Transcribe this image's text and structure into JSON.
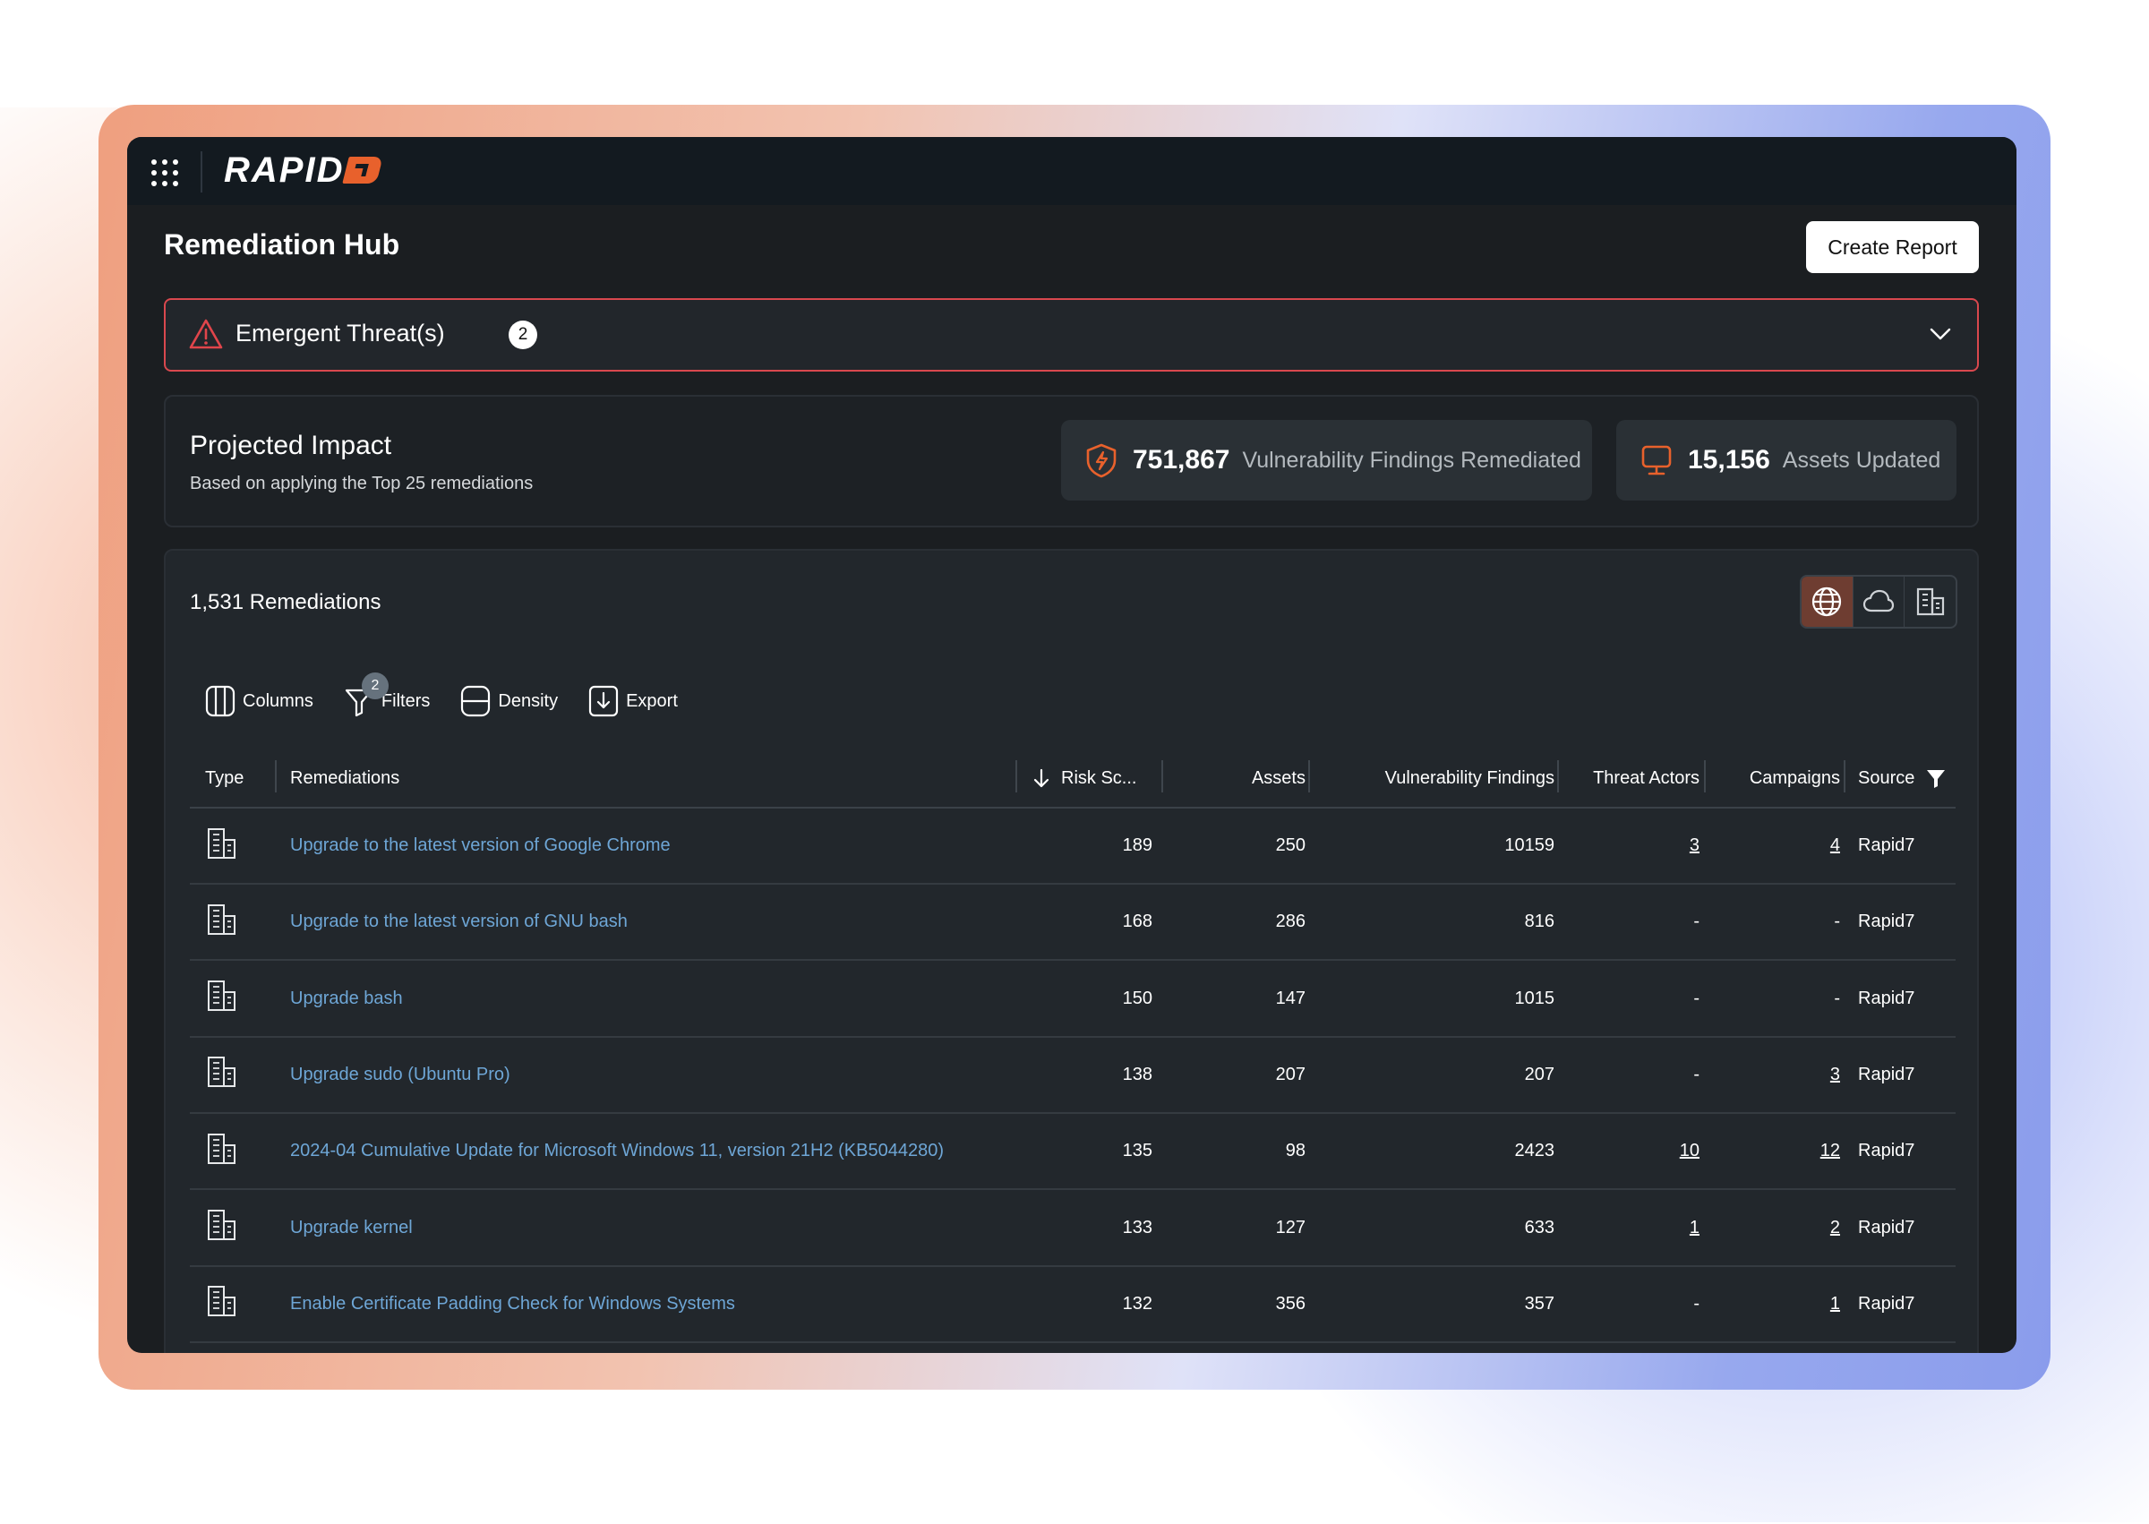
{
  "app": {
    "logo_text": "RAPID",
    "page_title": "Remediation Hub",
    "create_report_label": "Create Report"
  },
  "emergent": {
    "label": "Emergent Threat(s)",
    "count": "2"
  },
  "impact": {
    "title": "Projected Impact",
    "subtitle": "Based on applying the Top 25 remediations",
    "findings_value": "751,867",
    "findings_label": "Vulnerability Findings Remediated",
    "assets_value": "15,156",
    "assets_label": "Assets Updated"
  },
  "table": {
    "count_label": "1,531 Remediations",
    "view_modes": [
      "globe-icon",
      "cloud-icon",
      "building-icon"
    ],
    "toolbar": {
      "columns": "Columns",
      "filters": "Filters",
      "filters_count": "2",
      "density": "Density",
      "export": "Export"
    },
    "headers": {
      "type": "Type",
      "remediations": "Remediations",
      "risk": "Risk Sc...",
      "assets": "Assets",
      "findings": "Vulnerability Findings",
      "actors": "Threat Actors",
      "campaigns": "Campaigns",
      "source": "Source"
    },
    "rows": [
      {
        "name": "Upgrade to the latest version of Google Chrome",
        "risk": "189",
        "assets": "250",
        "findings": "10159",
        "actors": "3",
        "campaigns": "4",
        "source": "Rapid7"
      },
      {
        "name": "Upgrade to the latest version of GNU bash",
        "risk": "168",
        "assets": "286",
        "findings": "816",
        "actors": "-",
        "campaigns": "-",
        "source": "Rapid7"
      },
      {
        "name": "Upgrade bash",
        "risk": "150",
        "assets": "147",
        "findings": "1015",
        "actors": "-",
        "campaigns": "-",
        "source": "Rapid7"
      },
      {
        "name": "Upgrade sudo (Ubuntu Pro)",
        "risk": "138",
        "assets": "207",
        "findings": "207",
        "actors": "-",
        "campaigns": "3",
        "source": "Rapid7"
      },
      {
        "name": "2024-04 Cumulative Update for Microsoft Windows 11, version 21H2 (KB5044280)",
        "risk": "135",
        "assets": "98",
        "findings": "2423",
        "actors": "10",
        "campaigns": "12",
        "source": "Rapid7"
      },
      {
        "name": "Upgrade kernel",
        "risk": "133",
        "assets": "127",
        "findings": "633",
        "actors": "1",
        "campaigns": "2",
        "source": "Rapid7"
      },
      {
        "name": "Enable Certificate Padding Check for Windows Systems",
        "risk": "132",
        "assets": "356",
        "findings": "357",
        "actors": "-",
        "campaigns": "1",
        "source": "Rapid7"
      }
    ]
  },
  "colors": {
    "accent_orange": "#e8612c",
    "danger_red": "#d9484e",
    "link_blue": "#6ea6d6",
    "panel_bg": "#22272c"
  }
}
